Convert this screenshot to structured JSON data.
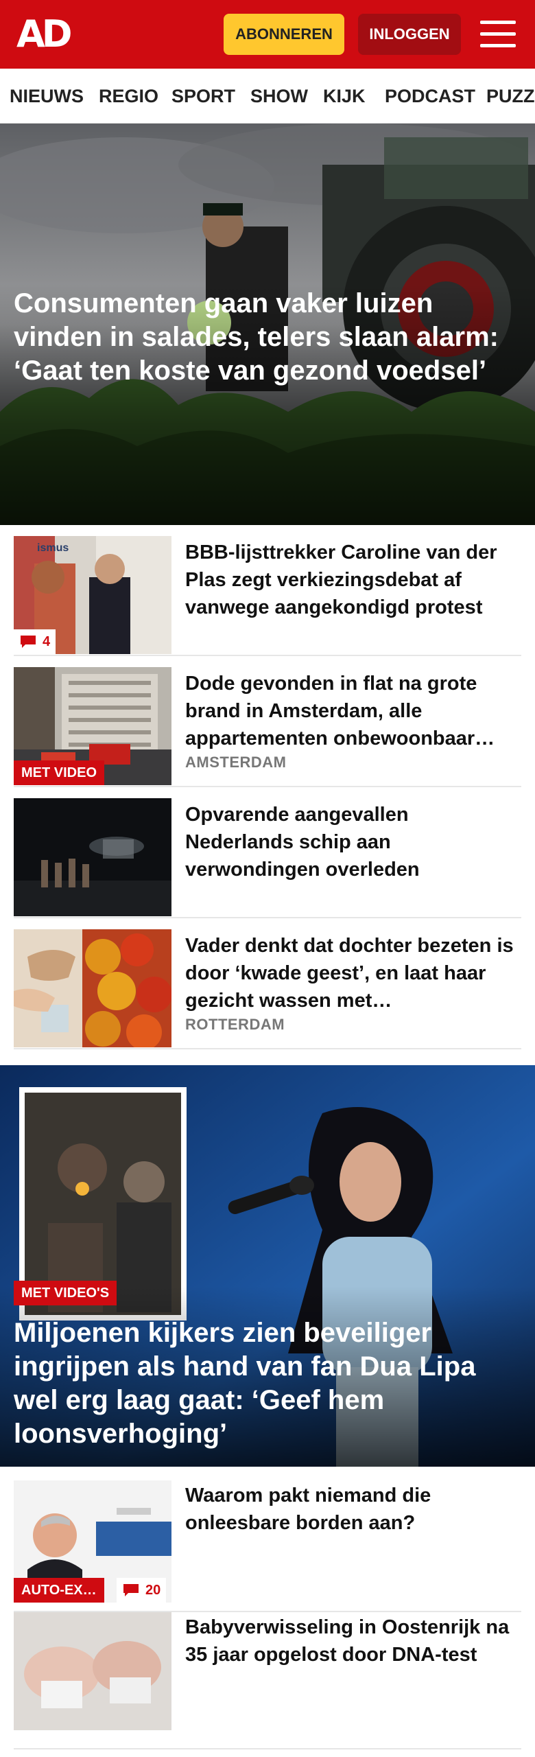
{
  "header": {
    "logo": "AD",
    "subscribe_label": "ABONNEREN",
    "login_label": "INLOGGEN",
    "menu_icon": "hamburger-menu-icon",
    "brand_color": "#cf0b11",
    "subscribe_color": "#ffc72e"
  },
  "nav": {
    "items": [
      "NIEUWS",
      "REGIO",
      "SPORT",
      "SHOW",
      "KIJK",
      "PODCAST",
      "PUZZ"
    ]
  },
  "hero": {
    "title": "Consumenten gaan vaker luizen vinden in salades, telers slaan alarm: ‘Gaat ten koste van gezond voedsel’"
  },
  "stories": [
    {
      "title": "BBB-lijsttrekker Caroline van der Plas zegt verkiezingsdebat af vanwege aangekondigd protest",
      "comments": "4",
      "thumb_text": "ismus"
    },
    {
      "title": "Dode gevonden in flat na grote brand in Amsterdam, alle appartementen onbewoonbaar…",
      "location": "AMSTERDAM",
      "badge": "MET VIDEO"
    },
    {
      "title": "Opvarende aangevallen Nederlands schip aan verwondingen overleden"
    },
    {
      "title": "Vader denkt dat dochter bezeten is door ‘kwade geest’, en laat haar gezicht wassen met…",
      "location": "ROTTERDAM"
    }
  ],
  "feature": {
    "badge": "MET VIDEO'S",
    "title": "Miljoenen kijkers zien beveiliger ingrijpen als hand van fan Dua Lipa wel erg laag gaat: ‘Geef hem loonsverhoging’"
  },
  "stories2": [
    {
      "title": "Waarom pakt niemand die onleesbare borden aan?",
      "badge": "AUTO-EX…",
      "comments": "20"
    },
    {
      "title": "Babyverwisseling in Oostenrijk na 35 jaar opgelost door DNA-test"
    }
  ]
}
